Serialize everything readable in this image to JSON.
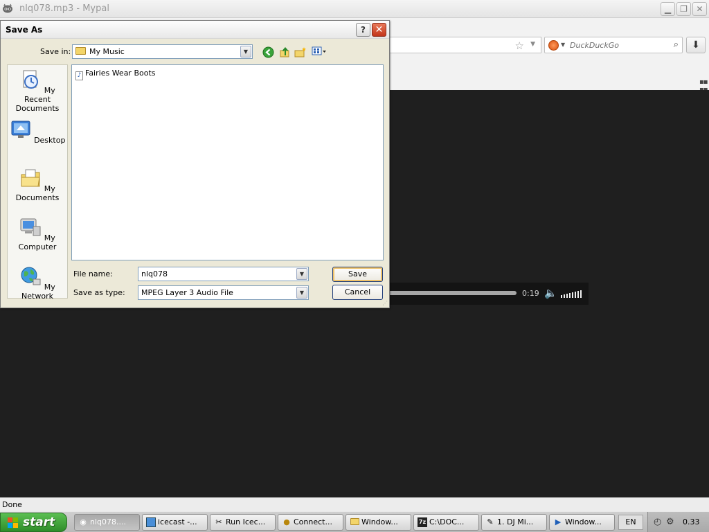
{
  "browser": {
    "title": "nlq078.mp3 - Mypal",
    "search_placeholder": "DuckDuckGo",
    "status": "Done"
  },
  "player": {
    "time": "0:19",
    "played_fraction": 0.75
  },
  "dialog": {
    "title": "Save As",
    "help_label": "?",
    "close_label": "✕",
    "save_in_label": "Save in:",
    "save_in_value": "My Music",
    "places": [
      {
        "label": "My Recent Documents"
      },
      {
        "label": "Desktop"
      },
      {
        "label": "My Documents"
      },
      {
        "label": "My Computer"
      },
      {
        "label": "My Network"
      }
    ],
    "files": [
      "Fairies Wear Boots"
    ],
    "file_name_label": "File name:",
    "file_name_value": "nlq078",
    "save_type_label": "Save as type:",
    "save_type_value": "MPEG Layer 3 Audio File",
    "save_button": "Save",
    "cancel_button": "Cancel"
  },
  "taskbar": {
    "start_label": "start",
    "tasks": [
      {
        "label": "nlq078....",
        "icon": "raccoon-icon"
      },
      {
        "label": "icecast -...",
        "icon": "icecast-icon"
      },
      {
        "label": "Run Icec...",
        "icon": "tools-icon"
      },
      {
        "label": "Connect...",
        "icon": "medal-icon"
      },
      {
        "label": "Window...",
        "icon": "folder-icon"
      },
      {
        "label": "C:\\DOC...",
        "icon": "7zip-icon"
      },
      {
        "label": "1. DJ Mi...",
        "icon": "pencil-icon"
      },
      {
        "label": "Window...",
        "icon": "media-player-icon"
      }
    ],
    "language": "EN",
    "clock": "0.33"
  }
}
